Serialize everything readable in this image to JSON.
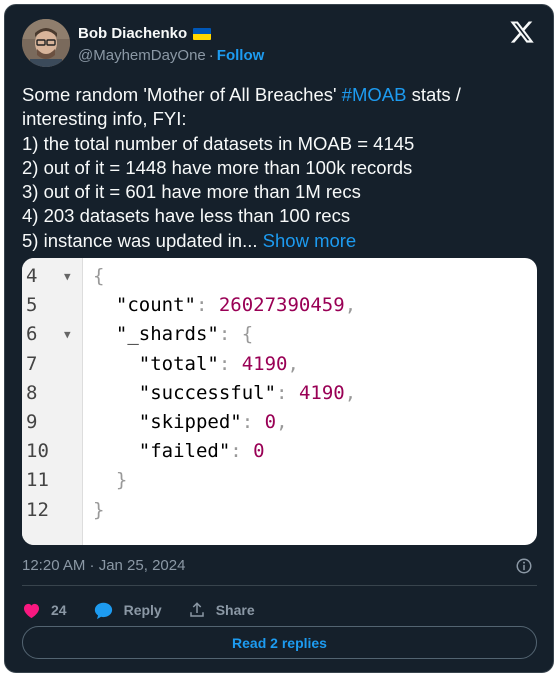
{
  "author": {
    "name": "Bob Diachenko",
    "handle": "@MayhemDayOne",
    "separator": "·",
    "follow_label": "Follow"
  },
  "tweet": {
    "line1_before": "Some random 'Mother of All Breaches' ",
    "line1_hashtag": "#MOAB",
    "line1_after": " stats /",
    "line2": "interesting info, FYI:",
    "line3": "1) the total number of datasets in MOAB = 4145",
    "line4": "2) out of it = 1448 have more than 100k records",
    "line5": "3) out of it = 601 have more than 1M recs",
    "line6": "4) 203 datasets have less than 100 recs",
    "line7": "5) instance was updated in...",
    "show_more": "Show more"
  },
  "code": {
    "lines": [
      {
        "ln": "4",
        "fold": "▼",
        "indent": "",
        "key": "",
        "punct_open": "{",
        "value": "",
        "punct_close": ""
      },
      {
        "ln": "5",
        "fold": "",
        "indent": "  ",
        "key": "\"count\"",
        "punct_open": ": ",
        "value": "26027390459",
        "punct_close": ","
      },
      {
        "ln": "6",
        "fold": "▼",
        "indent": "  ",
        "key": "\"_shards\"",
        "punct_open": ": {",
        "value": "",
        "punct_close": ""
      },
      {
        "ln": "7",
        "fold": "",
        "indent": "    ",
        "key": "\"total\"",
        "punct_open": ": ",
        "value": "4190",
        "punct_close": ","
      },
      {
        "ln": "8",
        "fold": "",
        "indent": "    ",
        "key": "\"successful\"",
        "punct_open": ": ",
        "value": "4190",
        "punct_close": ","
      },
      {
        "ln": "9",
        "fold": "",
        "indent": "    ",
        "key": "\"skipped\"",
        "punct_open": ": ",
        "value": "0",
        "punct_close": ","
      },
      {
        "ln": "10",
        "fold": "",
        "indent": "    ",
        "key": "\"failed\"",
        "punct_open": ": ",
        "value": "0",
        "punct_close": ""
      },
      {
        "ln": "11",
        "fold": "",
        "indent": "  ",
        "key": "",
        "punct_open": "}",
        "value": "",
        "punct_close": ""
      },
      {
        "ln": "12",
        "fold": "",
        "indent": "",
        "key": "",
        "punct_open": "}",
        "value": "",
        "punct_close": ""
      }
    ]
  },
  "meta": {
    "timestamp": "12:20 AM · Jan 25, 2024"
  },
  "actions": {
    "like_count": "24",
    "reply_label": "Reply",
    "share_label": "Share",
    "read_replies_label": "Read 2 replies"
  },
  "colors": {
    "background": "#15202b",
    "accent": "#1d9bf0",
    "like": "#f91880",
    "number": "#990055"
  },
  "icons": [
    "x-logo-icon",
    "ukraine-flag-icon",
    "info-icon",
    "heart-icon",
    "reply-bubble-icon",
    "share-icon",
    "fold-arrow-icon"
  ]
}
